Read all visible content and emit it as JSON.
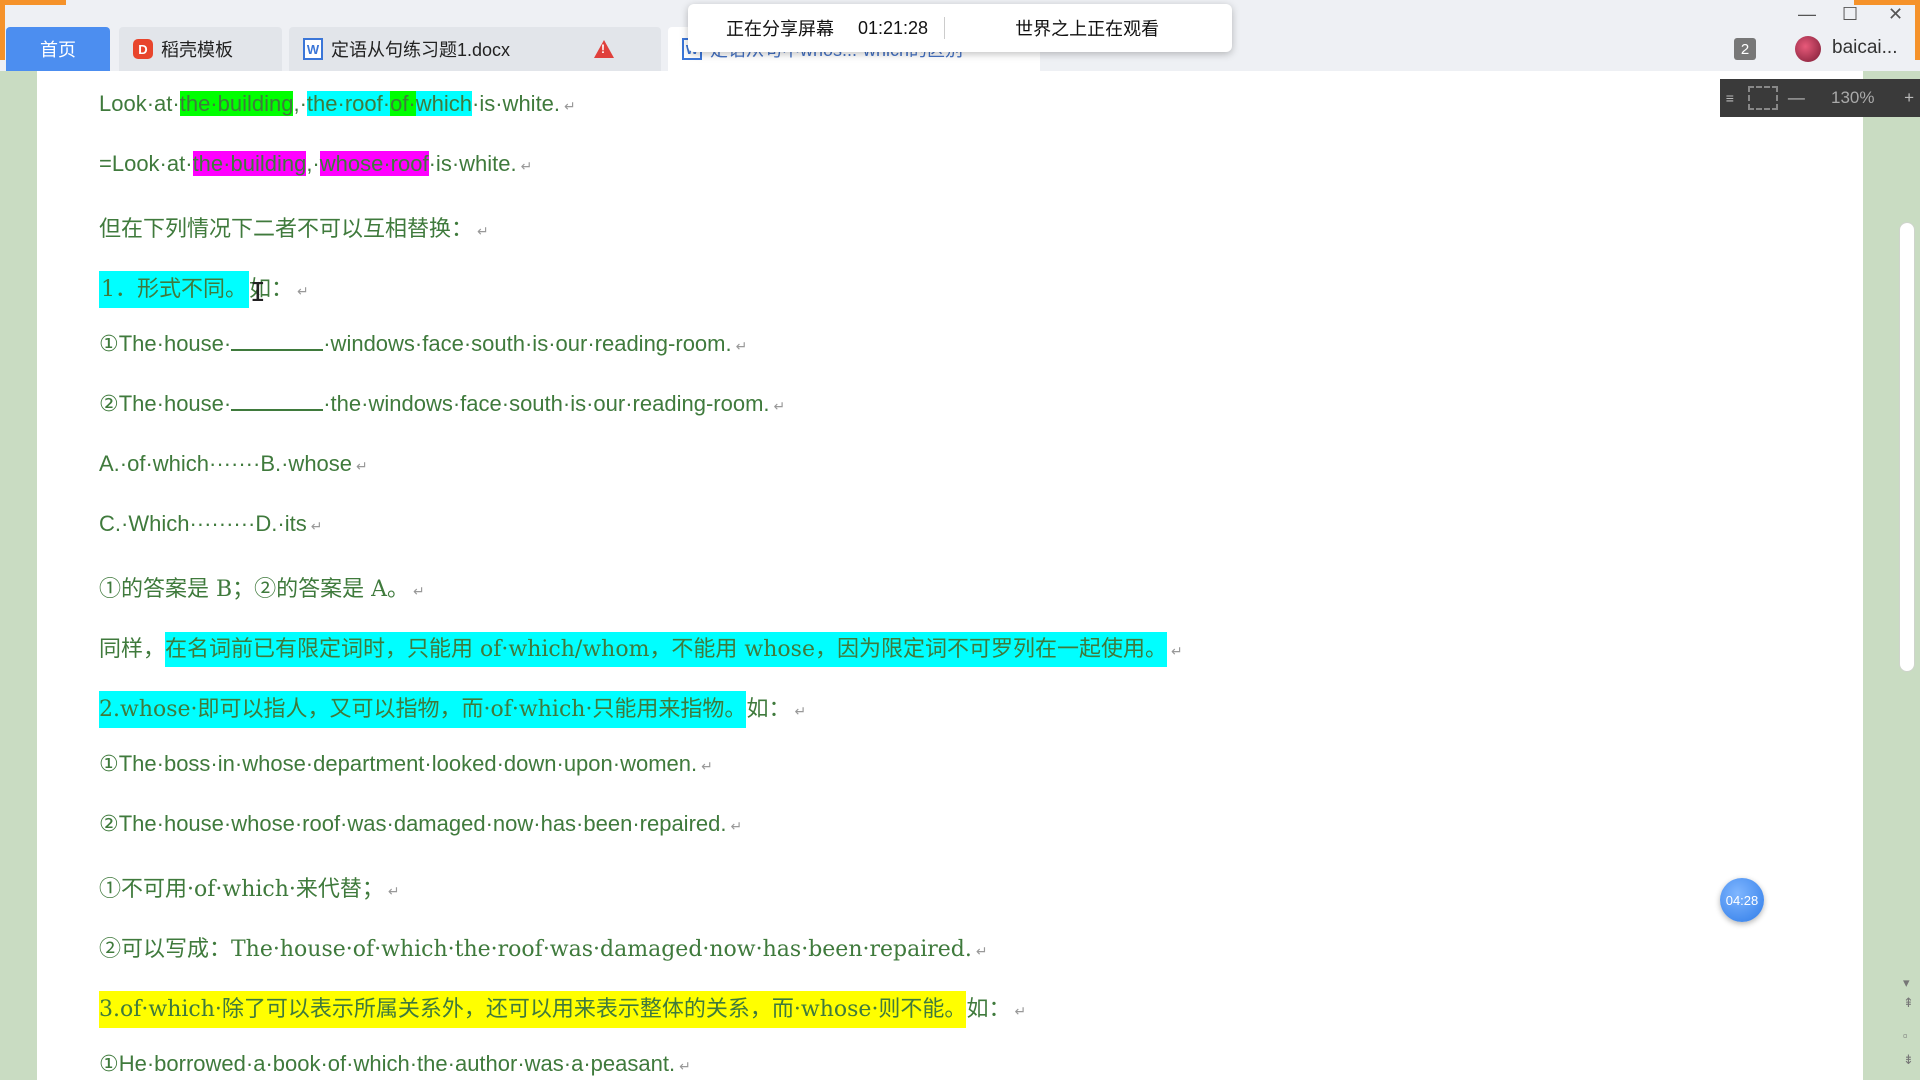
{
  "tabs": {
    "home": "首页",
    "template": "稻壳模板",
    "doc1": "定语从句练习题1.docx",
    "doc2": "定语从句中whos...-which的区别"
  },
  "share": {
    "status": "正在分享屏幕",
    "time": "01:21:28",
    "watching": "世界之上正在观看"
  },
  "window": {
    "minimize": "—",
    "maximize": "☐",
    "close": "✕"
  },
  "account": {
    "count": "2",
    "username": "baicai..."
  },
  "zoom": {
    "value": "130%",
    "minus": "—",
    "plus": "+"
  },
  "timer": "04:28",
  "doc": {
    "l1": {
      "a": "Look·at·",
      "b": "the·building",
      "c": ",·",
      "d": "the·roof·",
      "e": "of·",
      "f": "which",
      "g": "·is·white."
    },
    "l2": {
      "a": "=Look·at·",
      "b": "the·building",
      "c": ",·",
      "d": "whose·roof",
      "e": "·is·white."
    },
    "l3": "但在下列情况下二者不可以互相替换：",
    "l4": {
      "a": "1．形式不同。",
      "b": "如："
    },
    "l5": {
      "a": "①The·house·",
      "b": "·windows·face·south·is·our·reading-room."
    },
    "l6": {
      "a": "②The·house·",
      "b": "·the·windows·face·south·is·our·reading-room."
    },
    "l7": "A.·of·which·······B.·whose",
    "l8": "C.·Which·········D.·its",
    "l9": "①的答案是 B；②的答案是 A。",
    "l10": {
      "a": "同样，",
      "b": "在名词前已有限定词时，只能用 of·which/whom，不能用 whose，因为限定词不可罗列在一起使用。"
    },
    "l11": {
      "a": "2.whose·即可以指人，又可以指物，而·of·which·只能用来指物。",
      "b": "如："
    },
    "l12": "①The·boss·in·whose·department·looked·down·upon·women.",
    "l13": "②The·house·whose·roof·was·damaged·now·has·been·repaired.",
    "l14": "①不可用·of·which·来代替；",
    "l15": "②可以写成：The·house·of·which·the·roof·was·damaged·now·has·been·repaired.",
    "l16": {
      "a": "3.of·which·除了可以表示所属关系外，还可以用来表示整体的关系，而·whose·则不能。",
      "b": "如："
    },
    "l17": "①He·borrowed·a·book·of·which·the·author·was·a·peasant."
  },
  "colors": {
    "text": "#3f7a3c",
    "bg": "#c9dcc2",
    "accent": "#f5922a"
  }
}
